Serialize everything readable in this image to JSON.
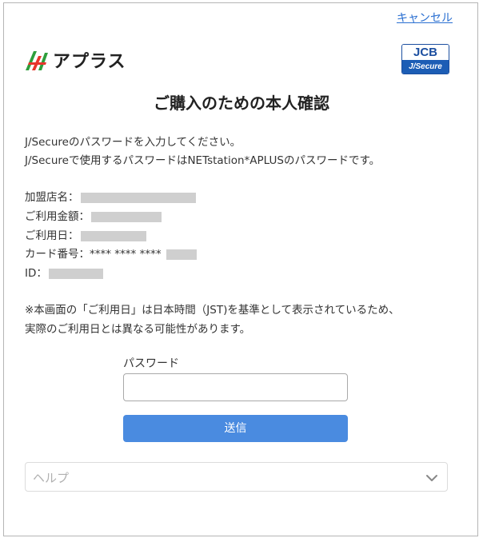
{
  "header": {
    "cancel_label": "キャンセル",
    "brand_name": "アプラス",
    "jcb_top": "JCB",
    "jcb_bottom": "J/Secure"
  },
  "title": "ご購入のための本人確認",
  "intro": [
    "J/Secureのパスワードを入力してください。",
    "J/Secureで使用するパスワードはNETstation*APLUSのパスワードです。"
  ],
  "details": {
    "merchant_label": "加盟店名：",
    "amount_label": "ご利用金額：",
    "date_label": "ご利用日：",
    "card_label": "カード番号：",
    "card_masked": "**** **** ****",
    "id_label": "ID："
  },
  "notice": [
    "※本画面の「ご利用日」は日本時間（JST)を基準として表示されているため、",
    "実際のご利用日とは異なる可能性があります。"
  ],
  "form": {
    "password_label": "パスワード",
    "password_value": "",
    "submit_label": "送信"
  },
  "help": {
    "label": "ヘルプ"
  },
  "colors": {
    "accent": "#4a8be0",
    "link": "#2a6fd1",
    "jcb_blue": "#1c5db5"
  }
}
